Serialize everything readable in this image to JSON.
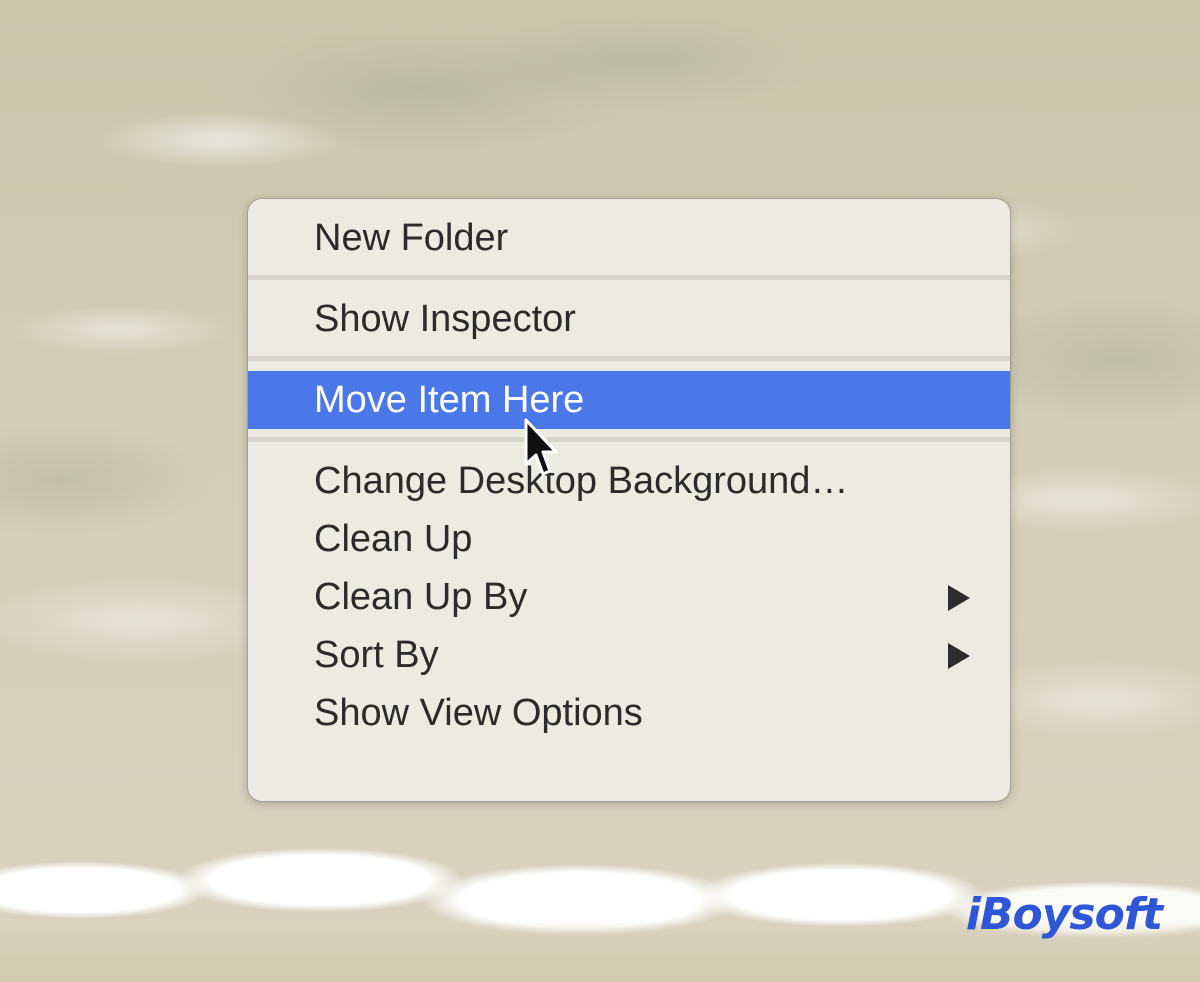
{
  "context_menu": {
    "items": [
      {
        "label": "New Folder"
      },
      {
        "label": "Show Inspector"
      },
      {
        "label": "Move Item Here",
        "highlighted": true
      },
      {
        "label": "Change Desktop Background…"
      },
      {
        "label": "Clean Up"
      },
      {
        "label": "Clean Up By",
        "has_submenu": true
      },
      {
        "label": "Sort By",
        "has_submenu": true
      },
      {
        "label": "Show View Options"
      }
    ]
  },
  "watermark": {
    "brand": "iBoysoft"
  },
  "colors": {
    "highlight": "#4a78e8",
    "menu_background": "#ecebe3",
    "menu_text": "#2b2b2b",
    "brand": "#2f56d6"
  },
  "icons": {
    "cursor": "arrow-pointer-icon",
    "submenu": "triangle-right-icon"
  }
}
